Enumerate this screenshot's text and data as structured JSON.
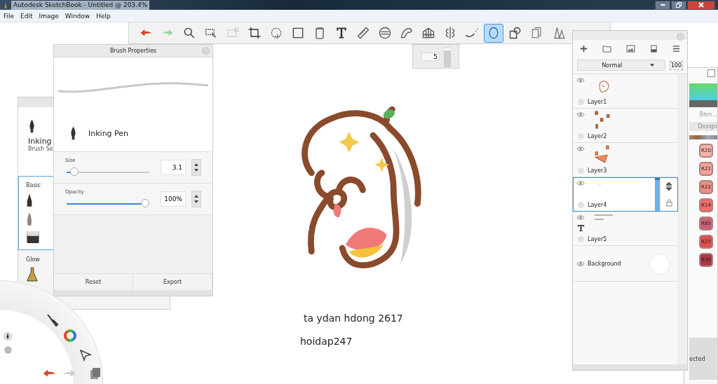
{
  "window": {
    "title": "Autodesk SketchBook - Untitled @ 203.4%"
  },
  "menu": [
    "File",
    "Edit",
    "Image",
    "Window",
    "Help"
  ],
  "toolbar": {
    "tools": [
      {
        "kind": "undo",
        "selected": false
      },
      {
        "kind": "redo",
        "selected": false
      },
      {
        "kind": "zoom",
        "selected": false
      },
      {
        "kind": "select",
        "selected": false
      },
      {
        "kind": "deselect",
        "selected": false
      },
      {
        "kind": "crop",
        "selected": false
      },
      {
        "kind": "move",
        "selected": false
      },
      {
        "kind": "distort",
        "selected": false
      },
      {
        "kind": "fill",
        "selected": false
      },
      {
        "kind": "text",
        "selected": false
      },
      {
        "kind": "ruler",
        "selected": false
      },
      {
        "kind": "ellipse-guide",
        "selected": false
      },
      {
        "kind": "curve",
        "selected": false
      },
      {
        "kind": "perspective",
        "selected": false
      },
      {
        "kind": "symmetry",
        "selected": false
      },
      {
        "kind": "stroke",
        "selected": false
      },
      {
        "kind": "ellipse",
        "selected": true
      },
      {
        "kind": "shapes",
        "selected": false
      },
      {
        "kind": "copy",
        "selected": false
      },
      {
        "kind": "brushes",
        "selected": false
      }
    ]
  },
  "size_popup": {
    "value": "5",
    "level": 0.9
  },
  "brush_library": {
    "brush_name": "Inking",
    "subtitle": "Brush Se",
    "sections": [
      {
        "label": "Basic",
        "selected": true
      },
      {
        "label": "Glow",
        "selected": false
      }
    ]
  },
  "brush_properties": {
    "title": "Brush Properties",
    "brush": "Inking Pen",
    "size": {
      "label": "Size",
      "level": 0.05,
      "value": "3.1"
    },
    "opacity": {
      "label": "Opacity",
      "level": 1,
      "value": "100%"
    },
    "buttons": [
      "Reset",
      "Export"
    ]
  },
  "layers": {
    "blend_mode": "Normal",
    "opacity": "100",
    "items": [
      {
        "name": "Layer1",
        "kind": "paint",
        "selected": false
      },
      {
        "name": "Layer2",
        "kind": "paint",
        "selected": false
      },
      {
        "name": "Layer3",
        "kind": "paint",
        "selected": false
      },
      {
        "name": "Layer4",
        "kind": "paint",
        "selected": true
      },
      {
        "name": "Layer5",
        "kind": "text",
        "selected": false
      },
      {
        "name": "Background",
        "kind": "background",
        "selected": false
      }
    ]
  },
  "colors": {
    "tab": "Blen...",
    "library": "Design",
    "footer": "ected",
    "swatches": [
      {
        "label": "R20",
        "color": "#f4b2aa"
      },
      {
        "label": "R21",
        "color": "#f2a29b"
      },
      {
        "label": "R22",
        "color": "#ef8c86"
      },
      {
        "label": "R14",
        "color": "#ec6c6c"
      },
      {
        "label": "R85",
        "color": "#c9617a"
      },
      {
        "label": "R27",
        "color": "#dd4f4e"
      },
      {
        "label": "R39",
        "color": "#a93949"
      }
    ]
  },
  "canvas": {
    "texts": [
      "ta ydan hdong 2617",
      "hoidap247"
    ]
  }
}
